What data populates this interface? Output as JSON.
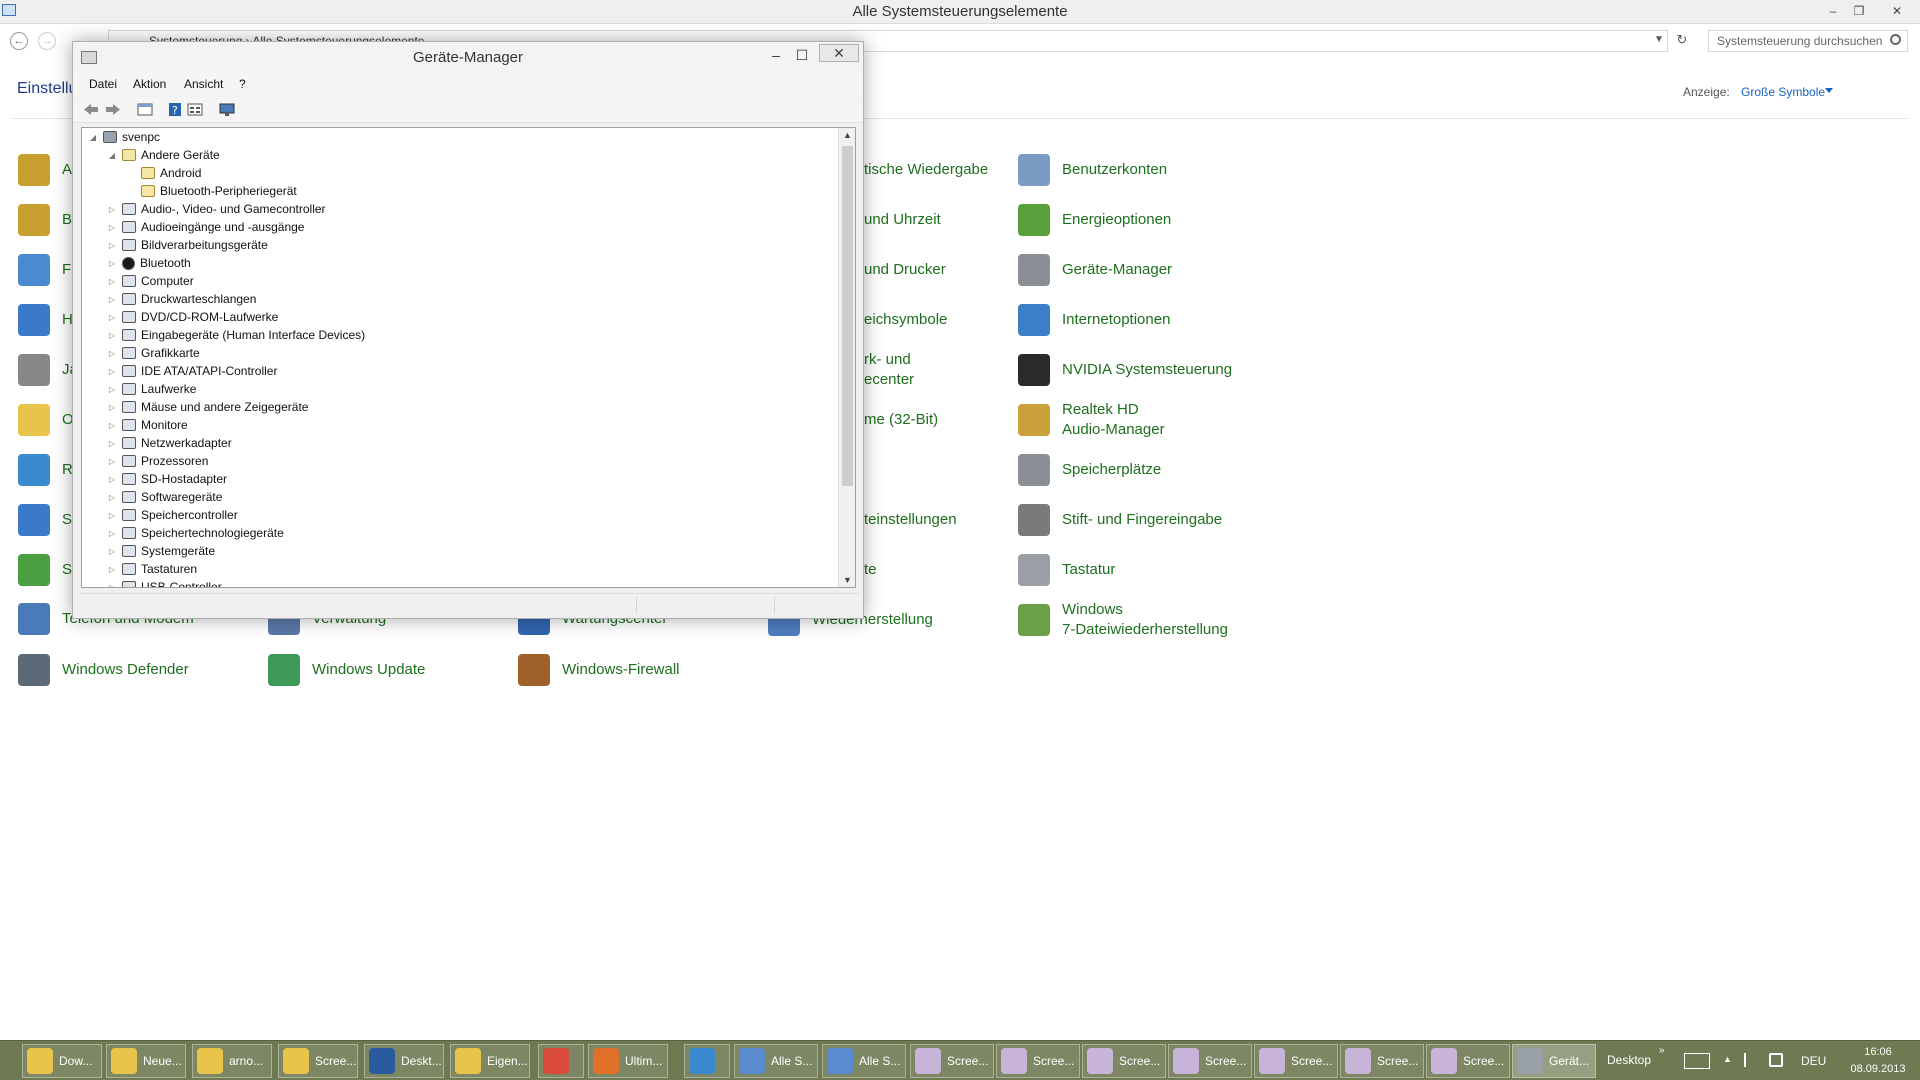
{
  "control_panel": {
    "window_title": "Alle Systemsteuerungselemente",
    "breadcrumb": "Systemsteuerung  ›  Alle Systemsteuerungselemente",
    "search_placeholder": "Systemsteuerung durchsuchen",
    "heading_partial": "Einstellu",
    "view_label": "Anzeige:",
    "view_value": "Große Symbole",
    "left_column_partial": [
      "A",
      "B",
      "F",
      "H",
      "Ja",
      "O",
      "R",
      "S",
      "S"
    ],
    "items": [
      {
        "label": "Telefon und Modem",
        "color": "#4a7ab8"
      },
      {
        "label": "Windows Defender",
        "color": "#5c6a78"
      },
      {
        "label": "Verwaltung",
        "color": "#5a78a8"
      },
      {
        "label": "Windows Update",
        "color": "#3f9a5a"
      },
      {
        "label": "Wartungscenter",
        "color": "#3264b0"
      },
      {
        "label": "Windows-Firewall",
        "color": "#a0602a"
      },
      {
        "label": "tische Wiedergabe",
        "color": ""
      },
      {
        "label": "und Uhrzeit",
        "color": ""
      },
      {
        "label": "und Drucker",
        "color": ""
      },
      {
        "label": "eichsymbole",
        "color": ""
      },
      {
        "label": "rk- und\necenter",
        "color": ""
      },
      {
        "label": "me (32-Bit)",
        "color": ""
      },
      {
        "label": "teinstellungen",
        "color": ""
      },
      {
        "label": "te",
        "color": ""
      },
      {
        "label": "Wiederherstellung",
        "color": "#4f7dbf"
      },
      {
        "label": "Benutzerkonten",
        "color": "#7a9cc4"
      },
      {
        "label": "Energieoptionen",
        "color": "#5aa03c"
      },
      {
        "label": "Geräte-Manager",
        "color": "#8a8f96"
      },
      {
        "label": "Internetoptionen",
        "color": "#3a7fc8"
      },
      {
        "label": "NVIDIA Systemsteuerung",
        "color": "#2a2a2a"
      },
      {
        "label": "Realtek HD\nAudio-Manager",
        "color": "#c9a03a"
      },
      {
        "label": "Speicherplätze",
        "color": "#8a9096"
      },
      {
        "label": "Stift- und Fingereingabe",
        "color": "#7a7a7a"
      },
      {
        "label": "Tastatur",
        "color": "#9aa0a6"
      },
      {
        "label": "Windows\n7-Dateiwiederherstellung",
        "color": "#6aa048"
      }
    ]
  },
  "device_manager": {
    "title": "Geräte-Manager",
    "menu": [
      "Datei",
      "Aktion",
      "Ansicht",
      "?"
    ],
    "toolbar": [
      "back-arrow-icon",
      "forward-arrow-icon",
      "properties-icon",
      "help-icon",
      "view-icon",
      "monitor-icon"
    ],
    "tree": [
      {
        "label": "svenpc",
        "expander": "◢",
        "type": "pc"
      },
      {
        "label": "Andere Geräte",
        "expander": "◢",
        "type": "warn"
      },
      {
        "label": "Android",
        "expander": "",
        "type": "warn"
      },
      {
        "label": "Bluetooth-Peripheriegerät",
        "expander": "",
        "type": "warn"
      },
      {
        "label": "Audio-, Video- und Gamecontroller",
        "expander": "▷",
        "type": "dev"
      },
      {
        "label": "Audioeingänge und -ausgänge",
        "expander": "▷",
        "type": "dev"
      },
      {
        "label": "Bildverarbeitungsgeräte",
        "expander": "▷",
        "type": "dev"
      },
      {
        "label": "Bluetooth",
        "expander": "▷",
        "type": "bt"
      },
      {
        "label": "Computer",
        "expander": "▷",
        "type": "dev"
      },
      {
        "label": "Druckwarteschlangen",
        "expander": "▷",
        "type": "dev"
      },
      {
        "label": "DVD/CD-ROM-Laufwerke",
        "expander": "▷",
        "type": "dev"
      },
      {
        "label": "Eingabegeräte (Human Interface Devices)",
        "expander": "▷",
        "type": "dev"
      },
      {
        "label": "Grafikkarte",
        "expander": "▷",
        "type": "dev"
      },
      {
        "label": "IDE ATA/ATAPI-Controller",
        "expander": "▷",
        "type": "dev"
      },
      {
        "label": "Laufwerke",
        "expander": "▷",
        "type": "dev"
      },
      {
        "label": "Mäuse und andere Zeigegeräte",
        "expander": "▷",
        "type": "dev"
      },
      {
        "label": "Monitore",
        "expander": "▷",
        "type": "dev"
      },
      {
        "label": "Netzwerkadapter",
        "expander": "▷",
        "type": "dev"
      },
      {
        "label": "Prozessoren",
        "expander": "▷",
        "type": "dev"
      },
      {
        "label": "SD-Hostadapter",
        "expander": "▷",
        "type": "dev"
      },
      {
        "label": "Softwaregeräte",
        "expander": "▷",
        "type": "dev"
      },
      {
        "label": "Speichercontroller",
        "expander": "▷",
        "type": "dev"
      },
      {
        "label": "Speichertechnologiegeräte",
        "expander": "▷",
        "type": "dev"
      },
      {
        "label": "Systemgeräte",
        "expander": "▷",
        "type": "dev"
      },
      {
        "label": "Tastaturen",
        "expander": "▷",
        "type": "dev"
      },
      {
        "label": "USB-Controller",
        "expander": "▷",
        "type": "dev"
      }
    ]
  },
  "taskbar": {
    "buttons": [
      {
        "label": "Dow...",
        "color": "#e8c44a"
      },
      {
        "label": "Neue...",
        "color": "#e8c44a"
      },
      {
        "label": "arno...",
        "color": "#e8c44a"
      },
      {
        "label": "Scree...",
        "color": "#e8c44a"
      },
      {
        "label": "Deskt...",
        "color": "#2a5aa0"
      },
      {
        "label": "Eigen...",
        "color": "#e8c44a"
      },
      {
        "label": "",
        "color": "#d84a3a"
      },
      {
        "label": "Ultim...",
        "color": "#e0702a"
      },
      {
        "label": "",
        "color": "#3a8ad0"
      },
      {
        "label": "Alle S...",
        "color": "#5a8ad0"
      },
      {
        "label": "Alle S...",
        "color": "#5a8ad0"
      },
      {
        "label": "Scree...",
        "color": "#c8b4d8"
      },
      {
        "label": "Scree...",
        "color": "#c8b4d8"
      },
      {
        "label": "Scree...",
        "color": "#c8b4d8"
      },
      {
        "label": "Scree...",
        "color": "#c8b4d8"
      },
      {
        "label": "Scree...",
        "color": "#c8b4d8"
      },
      {
        "label": "Scree...",
        "color": "#c8b4d8"
      },
      {
        "label": "Scree...",
        "color": "#c8b4d8"
      },
      {
        "label": "Gerät...",
        "color": "#9aa0a8"
      }
    ],
    "tray": {
      "desktop": "Desktop",
      "more": "»",
      "language": "DEU",
      "time": "16:06",
      "date": "08.09.2013"
    }
  }
}
